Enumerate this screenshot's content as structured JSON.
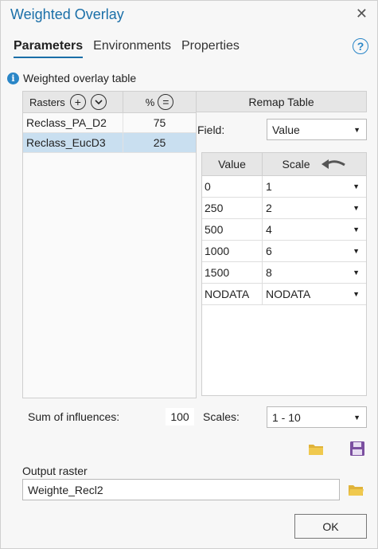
{
  "window": {
    "title": "Weighted Overlay",
    "close_glyph": "✕"
  },
  "tabs": [
    {
      "label": "Parameters",
      "active": true
    },
    {
      "label": "Environments",
      "active": false
    },
    {
      "label": "Properties",
      "active": false
    }
  ],
  "help_glyph": "?",
  "info": {
    "icon": "info-icon",
    "glyph": "i",
    "label": "Weighted overlay table"
  },
  "rasters": {
    "header_label": "Rasters",
    "add_glyph": "+",
    "move_glyph": "⌄",
    "percent_label": "%",
    "equal_glyph": "=",
    "rows": [
      {
        "name": "Reclass_PA_D2",
        "percent": "75",
        "selected": false
      },
      {
        "name": "Reclass_EucD3",
        "percent": "25",
        "selected": true
      }
    ]
  },
  "remap": {
    "title": "Remap Table",
    "field_label": "Field:",
    "field_value": "Value",
    "col_value": "Value",
    "col_scale": "Scale",
    "rows": [
      {
        "value": "0",
        "scale": "1"
      },
      {
        "value": "250",
        "scale": "2"
      },
      {
        "value": "500",
        "scale": "4"
      },
      {
        "value": "1000",
        "scale": "6"
      },
      {
        "value": "1500",
        "scale": "8"
      },
      {
        "value": "NODATA",
        "scale": "NODATA"
      }
    ]
  },
  "sum": {
    "label": "Sum of influences:",
    "value": "100"
  },
  "scales": {
    "label": "Scales:",
    "value": "1 - 10"
  },
  "output": {
    "label": "Output raster",
    "value": "Weighte_Recl2"
  },
  "ok_label": "OK",
  "colors": {
    "accent": "#1a6fa8",
    "folder": "#e0b33a",
    "save": "#7b4fa0",
    "selected_row": "#c9dff0"
  }
}
